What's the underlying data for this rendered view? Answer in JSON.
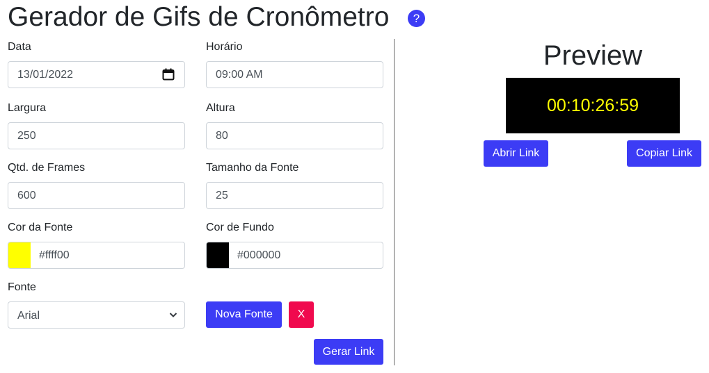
{
  "page": {
    "title": "Gerador de Gifs de Cronômetro",
    "help_label": "?"
  },
  "form": {
    "data": {
      "label": "Data",
      "value": "13/01/2022"
    },
    "horario": {
      "label": "Horário",
      "value": "09:00 AM"
    },
    "largura": {
      "label": "Largura",
      "value": "250"
    },
    "altura": {
      "label": "Altura",
      "value": "80"
    },
    "frames": {
      "label": "Qtd. de Frames",
      "value": "600"
    },
    "tamanho_fonte": {
      "label": "Tamanho da Fonte",
      "value": "25"
    },
    "cor_fonte": {
      "label": "Cor da Fonte",
      "value": "#ffff00"
    },
    "cor_fundo": {
      "label": "Cor de Fundo",
      "value": "#000000"
    },
    "fonte": {
      "label": "Fonte",
      "selected": "Arial"
    },
    "nova_fonte_label": "Nova Fonte",
    "remove_label": "X",
    "gerar_link_label": "Gerar Link"
  },
  "preview": {
    "title": "Preview",
    "timer": "00:10:26:59",
    "text_color": "#ffff00",
    "background": "#000000",
    "abrir_link_label": "Abrir Link",
    "copiar_link_label": "Copiar Link"
  },
  "colors": {
    "accent": "#3c3cf5",
    "danger": "#f00a4e"
  },
  "icons": {
    "help": "question-circle-icon",
    "calendar": "calendar-icon",
    "select": "chevron-down-icon"
  }
}
